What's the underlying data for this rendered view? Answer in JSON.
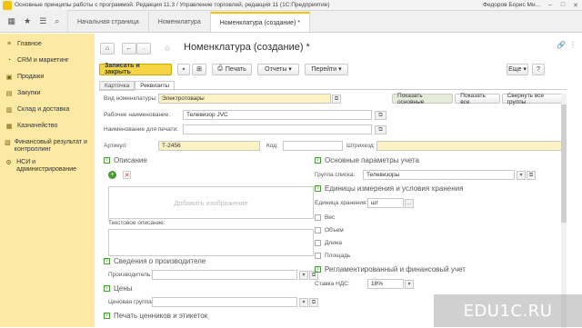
{
  "window": {
    "title": "Основные принципы работы с программой. Редакция 11.3 / Управление торговлей, редакция 11 (1С:Предприятие)",
    "user": "Федоров Борис Ми..."
  },
  "tabs": [
    {
      "label": "Начальная страница"
    },
    {
      "label": "Номенклатура"
    },
    {
      "label": "Номенклатура (создание) *"
    }
  ],
  "sidebar": {
    "items": [
      {
        "label": "Главное",
        "icon": "home-icon"
      },
      {
        "label": "CRM и маркетинг",
        "icon": "crm-icon"
      },
      {
        "label": "Продажи",
        "icon": "sales-icon"
      },
      {
        "label": "Закупки",
        "icon": "purchases-icon"
      },
      {
        "label": "Склад и доставка",
        "icon": "warehouse-icon"
      },
      {
        "label": "Казначейство",
        "icon": "treasury-icon"
      },
      {
        "label": "Финансовый результат и контроллинг",
        "icon": "finance-icon"
      },
      {
        "label": "НСИ и администрирование",
        "icon": "admin-icon"
      }
    ]
  },
  "form": {
    "title": "Номенклатура (создание) *",
    "toolbar": {
      "save_close": "Записать и закрыть",
      "print": "Печать",
      "reports": "Отчеты",
      "goto": "Перейти",
      "more": "Еще",
      "help": "?"
    },
    "form_tabs": [
      "Карточка",
      "Реквизиты"
    ],
    "view_buttons": [
      "Показать основные",
      "Показать все",
      "Свернуть все группы"
    ],
    "fields": {
      "kind_label": "Вид номенклатуры:",
      "kind_value": "Электротовары",
      "work_name_label": "Рабочее наименование:",
      "work_name_value": "Телевизор JVC",
      "print_name_label": "Наименование для печати:",
      "print_name_value": "",
      "article_label": "Артикул:",
      "article_value": "Т-2456",
      "code_label": "Код:",
      "code_value": "",
      "barcode_label": "Штрихкод:",
      "barcode_value": ""
    },
    "sections": {
      "description": "Описание",
      "add_image": "Добавить изображение",
      "text_description_label": "Текстовое описание:",
      "manufacturer": "Сведения о производителе",
      "manufacturer_label": "Производитель:",
      "prices": "Цены",
      "price_group_label": "Ценовая группа:",
      "price_tags": "Печать ценников и этикеток",
      "main_params": "Основные параметры учета",
      "list_group_label": "Группа списка:",
      "list_group_value": "Телевизоры",
      "units": "Единицы измерения и условия хранения",
      "storage_unit_label": "Единица хранения:",
      "storage_unit_value": "шт",
      "checkboxes": [
        "Вес",
        "Объем",
        "Длина",
        "Площадь"
      ],
      "regulated": "Регламентированный и финансовый учет",
      "vat_label": "Ставка НДС:",
      "vat_value": "18%"
    }
  },
  "watermark": "EDU1C.RU",
  "colors": {
    "accent": "#f5c400",
    "sidebar": "#fbe9a4",
    "section_green": "#4a9a35",
    "required_field": "#fdf2c4"
  }
}
